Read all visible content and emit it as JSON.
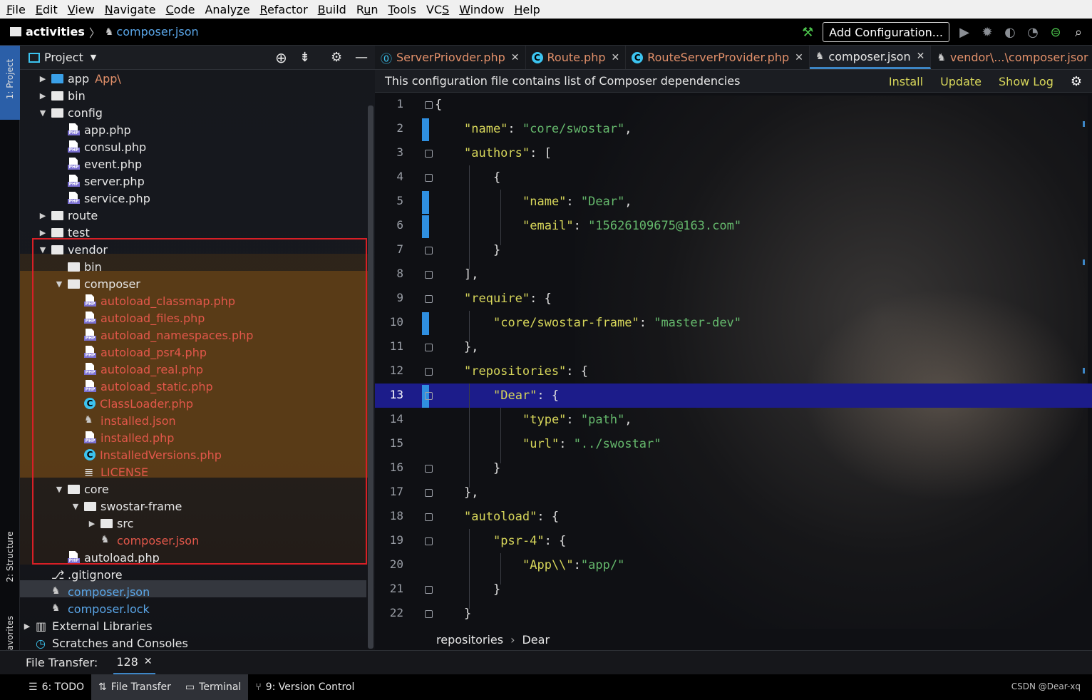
{
  "menu": [
    {
      "mn": "F",
      "rest": "ile"
    },
    {
      "mn": "E",
      "rest": "dit"
    },
    {
      "mn": "V",
      "rest": "iew"
    },
    {
      "mn": "N",
      "rest": "avigate"
    },
    {
      "mn": "C",
      "rest": "ode"
    },
    {
      "pre": "Analy",
      "mn": "z",
      "rest": "e"
    },
    {
      "mn": "R",
      "rest": "efactor"
    },
    {
      "mn": "B",
      "rest": "uild"
    },
    {
      "pre": "R",
      "mn": "u",
      "rest": "n"
    },
    {
      "mn": "T",
      "rest": "ools"
    },
    {
      "pre": "VC",
      "mn": "S",
      "rest": ""
    },
    {
      "mn": "W",
      "rest": "indow"
    },
    {
      "mn": "H",
      "rest": "elp"
    }
  ],
  "nav": {
    "project": "activities",
    "file": "composer.json",
    "add_config": "Add Configuration..."
  },
  "left_tabs": {
    "project": "1: Project",
    "structure": "2: Structure",
    "favorites": "Favorites"
  },
  "project_panel": {
    "title": "Project"
  },
  "tree": [
    {
      "label": "app",
      "extra": "App\\",
      "type": "folder-blue",
      "depth": 0,
      "arrow": "▶"
    },
    {
      "label": "bin",
      "type": "folder",
      "depth": 0,
      "arrow": "▶"
    },
    {
      "label": "config",
      "type": "folder",
      "depth": 0,
      "arrow": "▼"
    },
    {
      "label": "app.php",
      "type": "php",
      "depth": 1
    },
    {
      "label": "consul.php",
      "type": "php",
      "depth": 1
    },
    {
      "label": "event.php",
      "type": "php",
      "depth": 1
    },
    {
      "label": "server.php",
      "type": "php",
      "depth": 1
    },
    {
      "label": "service.php",
      "type": "php",
      "depth": 1
    },
    {
      "label": "route",
      "type": "folder",
      "depth": 0,
      "arrow": "▶"
    },
    {
      "label": "test",
      "type": "folder",
      "depth": 0,
      "arrow": "▶"
    },
    {
      "label": "vendor",
      "type": "folder",
      "depth": 0,
      "arrow": "▼"
    },
    {
      "label": "bin",
      "type": "folder",
      "depth": 1
    },
    {
      "label": "composer",
      "type": "folder",
      "depth": 1,
      "arrow": "▼"
    },
    {
      "label": "autoload_classmap.php",
      "type": "php",
      "depth": 2,
      "color": "#e2574a"
    },
    {
      "label": "autoload_files.php",
      "type": "php",
      "depth": 2,
      "color": "#e2574a"
    },
    {
      "label": "autoload_namespaces.php",
      "type": "php",
      "depth": 2,
      "color": "#e2574a"
    },
    {
      "label": "autoload_psr4.php",
      "type": "php",
      "depth": 2,
      "color": "#e2574a"
    },
    {
      "label": "autoload_real.php",
      "type": "php",
      "depth": 2,
      "color": "#e2574a"
    },
    {
      "label": "autoload_static.php",
      "type": "php",
      "depth": 2,
      "color": "#e2574a"
    },
    {
      "label": "ClassLoader.php",
      "type": "class",
      "depth": 2,
      "color": "#e2574a"
    },
    {
      "label": "installed.json",
      "type": "json",
      "depth": 2,
      "color": "#e2574a"
    },
    {
      "label": "installed.php",
      "type": "php",
      "depth": 2,
      "color": "#e2574a"
    },
    {
      "label": "InstalledVersions.php",
      "type": "class",
      "depth": 2,
      "color": "#e2574a"
    },
    {
      "label": "LICENSE",
      "type": "text",
      "depth": 2,
      "color": "#e2574a"
    },
    {
      "label": "core",
      "type": "folder",
      "depth": 1,
      "arrow": "▼"
    },
    {
      "label": "swostar-frame",
      "type": "folder",
      "depth": 2,
      "arrow": "▼"
    },
    {
      "label": "src",
      "type": "folder",
      "depth": 3,
      "arrow": "▶"
    },
    {
      "label": "composer.json",
      "type": "json",
      "depth": 3,
      "color": "#e2574a"
    },
    {
      "label": "autoload.php",
      "type": "php",
      "depth": 1
    },
    {
      "label": ".gitignore",
      "type": "git",
      "depth": 0
    },
    {
      "label": "composer.json",
      "type": "json",
      "depth": 0,
      "color": "#5aa6e8"
    },
    {
      "label": "composer.lock",
      "type": "json",
      "depth": 0,
      "color": "#5aa6e8"
    },
    {
      "label": "External Libraries",
      "type": "lib",
      "depth": -1,
      "arrow": "▶"
    },
    {
      "label": "Scratches and Consoles",
      "type": "scratch",
      "depth": -1
    }
  ],
  "tabs": [
    {
      "label": "ServerPriovder.php",
      "icon": "php"
    },
    {
      "label": "Route.php",
      "icon": "class"
    },
    {
      "label": "RouteServerProvider.php",
      "icon": "class"
    },
    {
      "label": "composer.json",
      "icon": "json",
      "active": true
    },
    {
      "label": "vendor\\...\\composer.jsor",
      "icon": "json"
    }
  ],
  "notify": {
    "text": "This configuration file contains list of Composer dependencies",
    "install": "Install",
    "update": "Update",
    "showlog": "Show Log"
  },
  "code": [
    "{",
    "    \"name\": \"core/swostar\",",
    "    \"authors\": [",
    "        {",
    "            \"name\": \"Dear\",",
    "            \"email\": \"15626109675@163.com\"",
    "        }",
    "    ],",
    "    \"require\": {",
    "        \"core/swostar-frame\": \"master-dev\"",
    "    },",
    "    \"repositories\": {",
    "        \"Dear\": {",
    "            \"type\": \"path\",",
    "            \"url\": \"../swostar\"",
    "        }",
    "    },",
    "    \"autoload\": {",
    "        \"psr-4\": {",
    "            \"App\\\\\":\"app/\"",
    "        }",
    "    }"
  ],
  "current_line": 13,
  "code_breadcrumb": {
    "a": "repositories",
    "sep": "›",
    "b": "Dear"
  },
  "file_transfer": {
    "label": "File Transfer:",
    "tab": "128"
  },
  "toolwindows": [
    {
      "label": "6: TODO",
      "icon": "☰"
    },
    {
      "label": "File Transfer",
      "icon": "⇅",
      "active": true
    },
    {
      "label": "Terminal",
      "icon": "▭",
      "active": true
    },
    {
      "label": "9: Version Control",
      "icon": "⑂"
    }
  ],
  "watermark": "CSDN @Dear-xq",
  "colors": {
    "accent": "#3d86c6",
    "keyword": "#d7d65a",
    "string": "#65b86c",
    "vcs_unversioned": "#e2574a",
    "modified": "#5aa6e8",
    "current_line": "#1c1c8a"
  }
}
